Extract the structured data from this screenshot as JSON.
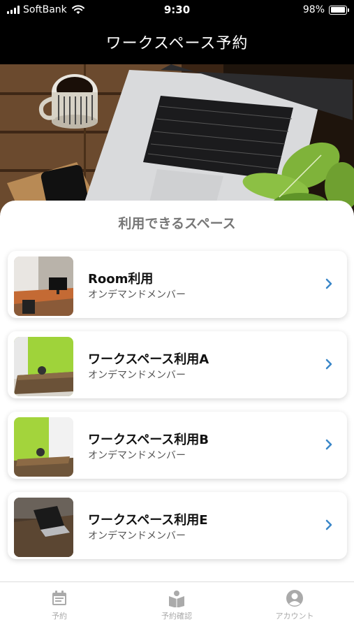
{
  "status": {
    "carrier": "SoftBank",
    "time": "9:30",
    "battery": "98%",
    "battery_level": 0.98
  },
  "header": {
    "title": "ワークスペース予約"
  },
  "section": {
    "title": "利用できるスペース"
  },
  "spaces": [
    {
      "title": "Room利用",
      "subtitle": "オンデマンドメンバー"
    },
    {
      "title": "ワークスペース利用A",
      "subtitle": "オンデマンドメンバー"
    },
    {
      "title": "ワークスペース利用B",
      "subtitle": "オンデマンドメンバー"
    },
    {
      "title": "ワークスペース利用E",
      "subtitle": "オンデマンドメンバー"
    }
  ],
  "tabs": [
    {
      "label": "予約",
      "icon": "calendar-icon"
    },
    {
      "label": "予約確認",
      "icon": "book-user-icon"
    },
    {
      "label": "アカウント",
      "icon": "account-icon"
    }
  ],
  "colors": {
    "accent": "#3a87c8",
    "header_bg": "#000000",
    "tab_inactive": "#aaaaaa"
  }
}
